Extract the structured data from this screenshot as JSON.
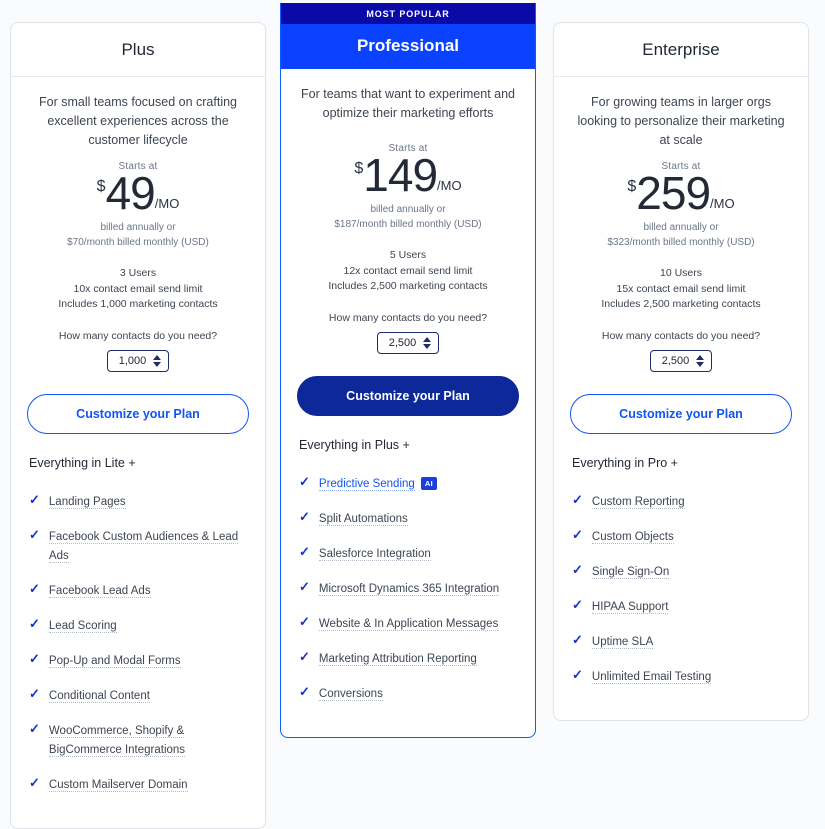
{
  "page": {
    "background_color": "#fafbfc",
    "accent_blue": "#1155f5",
    "featured_header_blue": "#0b42ff",
    "badge_navy": "#0a0aa8",
    "cta_solid_navy": "#0d2899",
    "check_color": "#1433cc"
  },
  "plans": [
    {
      "id": "plus",
      "name": "Plus",
      "featured": false,
      "badge": null,
      "description": "For small teams focused on crafting excellent experiences across the customer lifecycle",
      "starts_at_label": "Starts at",
      "currency_symbol": "$",
      "price": "49",
      "period": "/MO",
      "billing_line_1": "billed annually or",
      "billing_line_2": "$70/month billed monthly (USD)",
      "specs": [
        "3 Users",
        "10x contact email send limit",
        "Includes 1,000 marketing contacts"
      ],
      "contacts_question": "How many contacts do you need?",
      "contacts_value": "1,000",
      "cta_label": "Customize your Plan",
      "everything_label": "Everything in Lite +",
      "features": [
        {
          "label": "Landing Pages",
          "link": false,
          "badge": null
        },
        {
          "label": "Facebook Custom Audiences & Lead Ads",
          "link": false,
          "badge": null
        },
        {
          "label": "Facebook Lead Ads",
          "link": false,
          "badge": null
        },
        {
          "label": "Lead Scoring",
          "link": false,
          "badge": null
        },
        {
          "label": "Pop-Up and Modal Forms",
          "link": false,
          "badge": null
        },
        {
          "label": "Conditional Content",
          "link": false,
          "badge": null
        },
        {
          "label": "WooCommerce, Shopify & BigCommerce Integrations",
          "link": false,
          "badge": null
        },
        {
          "label": "Custom Mailserver Domain",
          "link": false,
          "badge": null
        }
      ]
    },
    {
      "id": "professional",
      "name": "Professional",
      "featured": true,
      "badge": "MOST POPULAR",
      "description": "For teams that want to experiment and optimize their marketing efforts",
      "starts_at_label": "Starts at",
      "currency_symbol": "$",
      "price": "149",
      "period": "/MO",
      "billing_line_1": "billed annually or",
      "billing_line_2": "$187/month billed monthly (USD)",
      "specs": [
        "5 Users",
        "12x contact email send limit",
        "Includes 2,500 marketing contacts"
      ],
      "contacts_question": "How many contacts do you need?",
      "contacts_value": "2,500",
      "cta_label": "Customize your Plan",
      "everything_label": "Everything in Plus +",
      "features": [
        {
          "label": "Predictive Sending",
          "link": true,
          "badge": "AI"
        },
        {
          "label": "Split Automations",
          "link": false,
          "badge": null
        },
        {
          "label": "Salesforce Integration",
          "link": false,
          "badge": null
        },
        {
          "label": "Microsoft Dynamics 365 Integration",
          "link": false,
          "badge": null
        },
        {
          "label": "Website & In Application Messages",
          "link": false,
          "badge": null
        },
        {
          "label": "Marketing Attribution Reporting",
          "link": false,
          "badge": null
        },
        {
          "label": "Conversions",
          "link": false,
          "badge": null
        }
      ]
    },
    {
      "id": "enterprise",
      "name": "Enterprise",
      "featured": false,
      "badge": null,
      "description": "For growing teams in larger orgs looking to personalize their marketing at scale",
      "starts_at_label": "Starts at",
      "currency_symbol": "$",
      "price": "259",
      "period": "/MO",
      "billing_line_1": "billed annually or",
      "billing_line_2": "$323/month billed monthly (USD)",
      "specs": [
        "10 Users",
        "15x contact email send limit",
        "Includes 2,500 marketing contacts"
      ],
      "contacts_question": "How many contacts do you need?",
      "contacts_value": "2,500",
      "cta_label": "Customize your Plan",
      "everything_label": "Everything in Pro +",
      "features": [
        {
          "label": "Custom Reporting",
          "link": false,
          "badge": null
        },
        {
          "label": "Custom Objects",
          "link": false,
          "badge": null
        },
        {
          "label": "Single Sign-On",
          "link": false,
          "badge": null
        },
        {
          "label": "HIPAA Support",
          "link": false,
          "badge": null
        },
        {
          "label": "Uptime SLA",
          "link": false,
          "badge": null
        },
        {
          "label": "Unlimited Email Testing",
          "link": false,
          "badge": null
        }
      ]
    }
  ]
}
